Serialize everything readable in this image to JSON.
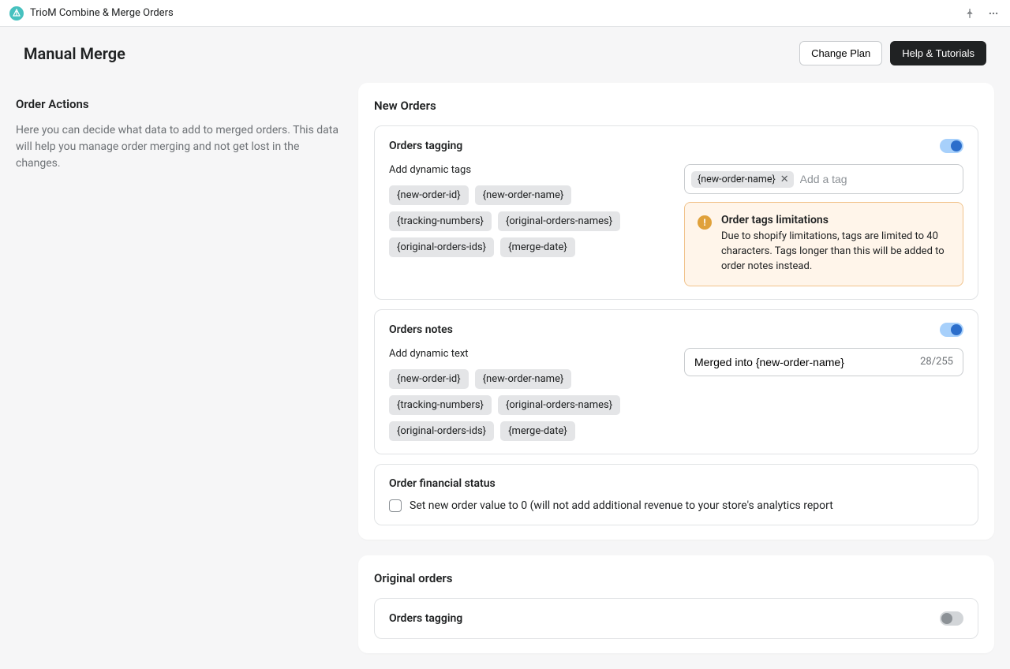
{
  "topbar": {
    "app_name": "TrioM Combine & Merge Orders"
  },
  "header": {
    "page_title": "Manual Merge",
    "change_plan": "Change Plan",
    "help": "Help & Tutorials"
  },
  "sidebar": {
    "title": "Order Actions",
    "description": "Here you can decide what data to add to merged orders. This data will help you manage order merging and not get lost in the changes."
  },
  "new_orders": {
    "title": "New Orders",
    "tagging": {
      "title": "Orders tagging",
      "label": "Add dynamic tags",
      "chips": [
        "{new-order-id}",
        "{new-order-name}",
        "{tracking-numbers}",
        "{original-orders-names}",
        "{original-orders-ids}",
        "{merge-date}"
      ],
      "selected_tag": "{new-order-name}",
      "placeholder": "Add a tag",
      "banner": {
        "title": "Order tags limitations",
        "text": "Due to shopify limitations, tags are limited to 40 characters. Tags longer than this will be added to order notes instead."
      }
    },
    "notes": {
      "title": "Orders notes",
      "label": "Add dynamic text",
      "chips": [
        "{new-order-id}",
        "{new-order-name}",
        "{tracking-numbers}",
        "{original-orders-names}",
        "{original-orders-ids}",
        "{merge-date}"
      ],
      "value": "Merged into {new-order-name}",
      "counter": "28/255"
    },
    "financial": {
      "title": "Order financial status",
      "checkbox_label": "Set new order value to 0 (will not add additional revenue to your store's analytics report"
    }
  },
  "original_orders": {
    "title": "Original orders",
    "tagging": {
      "title": "Orders tagging"
    }
  }
}
